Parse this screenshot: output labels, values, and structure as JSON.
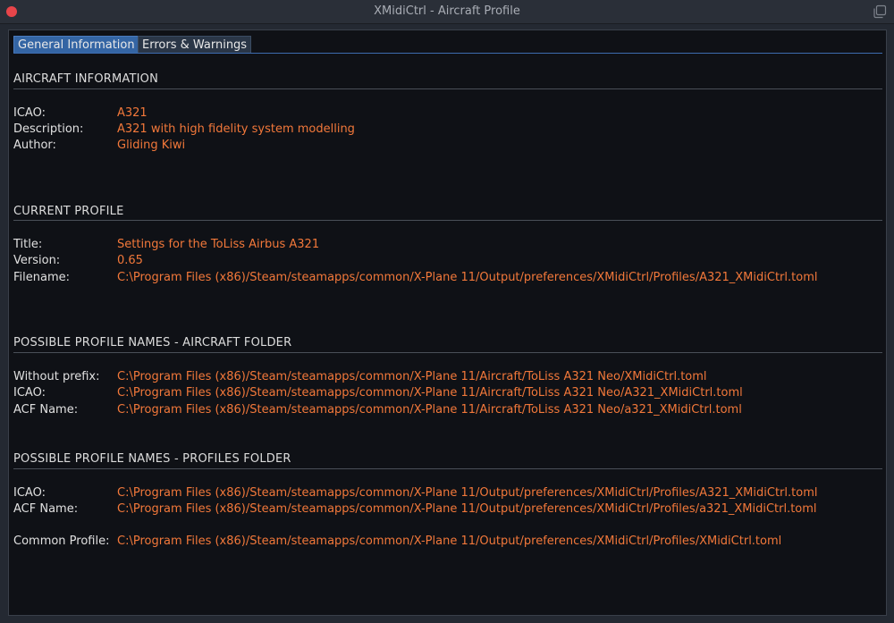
{
  "window": {
    "title": "XMidiCtrl - Aircraft Profile"
  },
  "tabs": [
    {
      "label": "General Information",
      "active": true
    },
    {
      "label": "Errors & Warnings",
      "active": false
    }
  ],
  "aircraft": {
    "heading": "AIRCRAFT INFORMATION",
    "icao_label": "ICAO:",
    "icao": "A321",
    "description_label": "Description:",
    "description": "A321 with high fidelity system modelling",
    "author_label": "Author:",
    "author": "Gliding Kiwi"
  },
  "profile": {
    "heading": "CURRENT PROFILE",
    "title_label": "Title:",
    "title": "Settings for the ToLiss Airbus A321",
    "version_label": "Version:",
    "version": "0.65",
    "filename_label": "Filename:",
    "filename": "C:\\Program Files (x86)/Steam/steamapps/common/X-Plane 11/Output/preferences/XMidiCtrl/Profiles/A321_XMidiCtrl.toml"
  },
  "aircraft_folder": {
    "heading": "POSSIBLE PROFILE NAMES - AIRCRAFT FOLDER",
    "no_prefix_label": "Without prefix:",
    "no_prefix": "C:\\Program Files (x86)/Steam/steamapps/common/X-Plane 11/Aircraft/ToLiss A321 Neo/XMidiCtrl.toml",
    "icao_label": "ICAO:",
    "icao": "C:\\Program Files (x86)/Steam/steamapps/common/X-Plane 11/Aircraft/ToLiss A321 Neo/A321_XMidiCtrl.toml",
    "acf_label": "ACF Name:",
    "acf": "C:\\Program Files (x86)/Steam/steamapps/common/X-Plane 11/Aircraft/ToLiss A321 Neo/a321_XMidiCtrl.toml"
  },
  "profiles_folder": {
    "heading": "POSSIBLE PROFILE NAMES - PROFILES FOLDER",
    "icao_label": "ICAO:",
    "icao": "C:\\Program Files (x86)/Steam/steamapps/common/X-Plane 11/Output/preferences/XMidiCtrl/Profiles/A321_XMidiCtrl.toml",
    "acf_label": "ACF Name:",
    "acf": "C:\\Program Files (x86)/Steam/steamapps/common/X-Plane 11/Output/preferences/XMidiCtrl/Profiles/a321_XMidiCtrl.toml",
    "common_label": "Common Profile:",
    "common": "C:\\Program Files (x86)/Steam/steamapps/common/X-Plane 11/Output/preferences/XMidiCtrl/Profiles/XMidiCtrl.toml"
  },
  "colors": {
    "value": "#f2783a",
    "tab_active": "#3465a4",
    "close": "#e8454a"
  }
}
